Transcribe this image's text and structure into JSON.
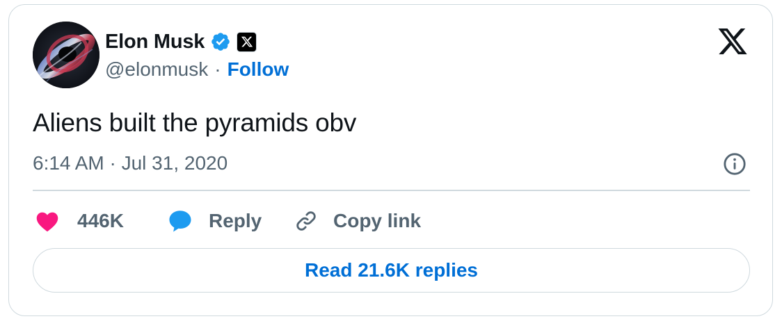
{
  "author": {
    "name": "Elon Musk",
    "handle": "@elonmusk",
    "separator": "·",
    "follow_label": "Follow",
    "verified_color": "#1d9bf0",
    "avatar_icon": "black-hole-avatar",
    "affiliation_icon": "x-logo-badge"
  },
  "brand": {
    "icon": "x-logo"
  },
  "tweet": {
    "text": "Aliens built the pyramids obv",
    "timestamp": "6:14 AM · Jul 31, 2020"
  },
  "actions": {
    "likes_count": "446K",
    "reply_label": "Reply",
    "copy_link_label": "Copy link",
    "like_color": "#f91880",
    "reply_color": "#1d9bf0"
  },
  "read_replies_label": "Read 21.6K replies",
  "colors": {
    "text": "#0f1419",
    "secondary": "#536471",
    "link": "#006fd6",
    "border": "#cfd9de"
  }
}
